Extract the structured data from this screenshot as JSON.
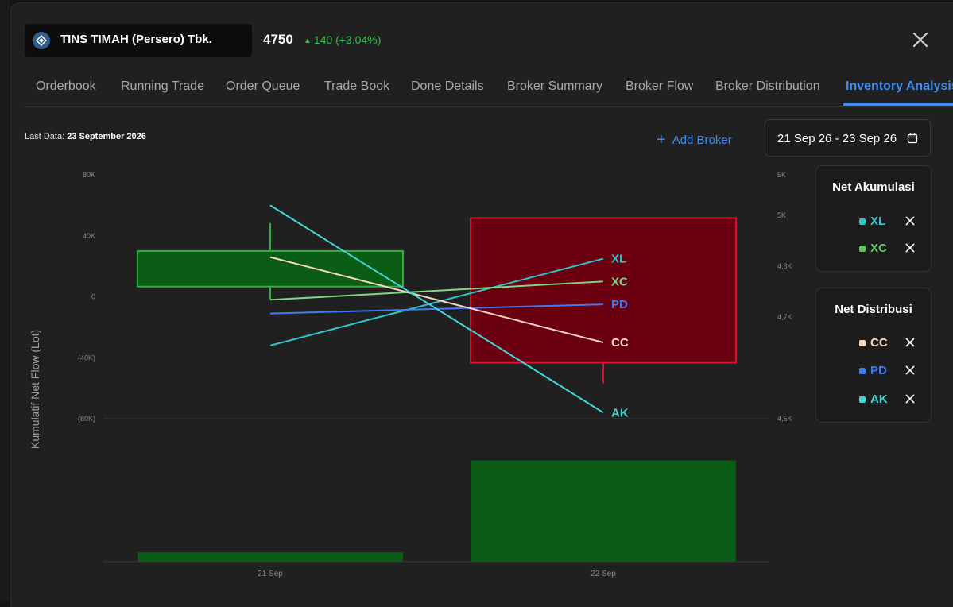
{
  "stock": {
    "name": "TINS TIMAH (Persero) Tbk.",
    "price": "4750",
    "change": "140 (+3.04%)"
  },
  "tabs": [
    {
      "label": "Orderbook"
    },
    {
      "label": "Running Trade"
    },
    {
      "label": "Order Queue"
    },
    {
      "label": "Trade Book"
    },
    {
      "label": "Done Details"
    },
    {
      "label": "Broker Summary"
    },
    {
      "label": "Broker Flow"
    },
    {
      "label": "Broker Distribution"
    },
    {
      "label": "Inventory Analysis",
      "active": true
    }
  ],
  "last_data": {
    "label": "Last Data:",
    "value": "23 September 2026"
  },
  "add_broker_label": "Add Broker",
  "date_range": "21 Sep 26 - 23 Sep 26",
  "chart_title": "Kumulatif Net Flow (Lot)",
  "net_akumulasi": {
    "title": "Net Akumulasi",
    "items": [
      {
        "code": "XL",
        "color": "#2ec4c9"
      },
      {
        "code": "XC",
        "color": "#5cc85c"
      }
    ]
  },
  "net_distribusi": {
    "title": "Net Distribusi",
    "items": [
      {
        "code": "CC",
        "color": "#f7d6c4"
      },
      {
        "code": "PD",
        "color": "#3d7cf5"
      },
      {
        "code": "AK",
        "color": "#3fd8d8"
      }
    ]
  },
  "chart_data": {
    "type": "line",
    "categories": [
      "21 Sep",
      "22 Sep"
    ],
    "ylabel": "Kumulatif Net Flow (Lot)",
    "left_axis_ticks": [
      "80K",
      "40K",
      "0",
      "(40K)",
      "(80K)"
    ],
    "left_axis_range": [
      -80000,
      80000
    ],
    "right_axis_ticks": [
      "5K",
      "5K",
      "4,8K",
      "4,7K",
      "4,5K"
    ],
    "right_axis_values": [
      4980,
      4900,
      4800,
      4700,
      4500
    ],
    "candles": [
      {
        "x": "21 Sep",
        "open": 4760,
        "close": 4830,
        "high": 4885,
        "low": 4735,
        "color": "#0b5d16",
        "border": "#2ab33d"
      },
      {
        "x": "22 Sep",
        "open": 4895,
        "close": 4610,
        "high": 4895,
        "low": 4570,
        "color": "#6a0010",
        "border": "#d5132d"
      }
    ],
    "series": [
      {
        "name": "XL",
        "color": "#2ec4c9",
        "values": [
          -32000,
          25000
        ]
      },
      {
        "name": "XC",
        "color": "#7fd97f",
        "values": [
          -2000,
          10000
        ]
      },
      {
        "name": "PD",
        "color": "#3d7cf5",
        "values": [
          -11000,
          -5000
        ]
      },
      {
        "name": "CC",
        "color": "#f7d6c4",
        "values": [
          26000,
          -30000
        ]
      },
      {
        "name": "AK",
        "color": "#3fd8d8",
        "values": [
          60000,
          -76000
        ]
      }
    ],
    "volume": [
      {
        "x": "21 Sep",
        "value": 6,
        "color": "#0b5d16"
      },
      {
        "x": "22 Sep",
        "value": 65,
        "color": "#0b5d16"
      }
    ]
  }
}
